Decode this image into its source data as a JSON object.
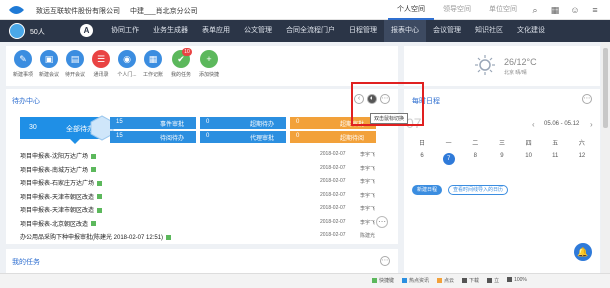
{
  "header": {
    "company": "致远互联软件股份有限公司",
    "branch": "中建___肖北京分公司",
    "tabs": [
      "个人空间",
      "领导空间",
      "单位空间"
    ],
    "active_tab": 0
  },
  "nav": {
    "user": "50人",
    "a_label": "A",
    "items": [
      "协同工作",
      "业务生成器",
      "表单应用",
      "公文管理",
      "合同全流程门户",
      "日程管理",
      "报表中心",
      "会议管理",
      "知识社区",
      "文化建设"
    ],
    "current_index": 6
  },
  "shortcuts": [
    {
      "label": "新建事项",
      "color": "#3b8de0",
      "glyph": "✎"
    },
    {
      "label": "新建会议",
      "color": "#3b8de0",
      "glyph": "▣"
    },
    {
      "label": "待开会议",
      "color": "#3b8de0",
      "glyph": "▤"
    },
    {
      "label": "通讯录",
      "color": "#e94343",
      "glyph": "☰"
    },
    {
      "label": "个人门...",
      "color": "#3b8de0",
      "glyph": "◉"
    },
    {
      "label": "工作记账",
      "color": "#3b8de0",
      "glyph": "▦"
    },
    {
      "label": "我的任务",
      "color": "#5cb85c",
      "glyph": "✔",
      "badge": "10"
    },
    {
      "label": "添加快捷",
      "color": "#5cb85c",
      "glyph": "+"
    }
  ],
  "todo": {
    "title": "待办中心",
    "all": {
      "count": "30",
      "label": "全部待办"
    },
    "categories": [
      {
        "count": "15",
        "label": "事件审批",
        "color": "#2b8fe0"
      },
      {
        "count": "0",
        "label": "超期待办",
        "color": "#2b8fe0"
      },
      {
        "count": "0",
        "label": "超期审批",
        "color": "#f2a13a"
      },
      {
        "count": "15",
        "label": "待阅待办",
        "color": "#2b8fe0"
      },
      {
        "count": "0",
        "label": "代理审批",
        "color": "#2b8fe0"
      },
      {
        "count": "0",
        "label": "超期待阅",
        "color": "#f2a13a"
      }
    ],
    "tasks": [
      {
        "title": "项目申报表-沈阳万达广场",
        "date": "2018-02-07",
        "user": "李宇飞"
      },
      {
        "title": "项目申报表-南城万达广场",
        "date": "2018-02-07",
        "user": "李宇飞"
      },
      {
        "title": "项目申报表-石家庄万达广场",
        "date": "2018-02-07",
        "user": "李宇飞"
      },
      {
        "title": "项目申报表-天津市朝区改造",
        "date": "2018-02-07",
        "user": "李宇飞"
      },
      {
        "title": "项目申报表-天津市朝区改造",
        "date": "2018-02-07",
        "user": "李宇飞"
      },
      {
        "title": "项目申报表-北京朝区改造",
        "date": "2018-02-07",
        "user": "李宇飞"
      },
      {
        "title": "办公用品采购下种申报审批(陈建光 2018-02-07 12:51)",
        "date": "2018-02-07",
        "user": "陈建光"
      }
    ]
  },
  "mytasks": {
    "title": "我的任务"
  },
  "weather": {
    "temp": "26/12°C",
    "sub": "北京 晴/晴"
  },
  "calendar": {
    "title": "每时日程",
    "big_month": "07",
    "range": "05.06 - 05.12",
    "weekdays": [
      "日",
      "一",
      "二",
      "三",
      "四",
      "五",
      "六"
    ],
    "days": [
      "6",
      "7",
      "8",
      "9",
      "10",
      "11",
      "12"
    ],
    "selected_index": 1,
    "btn_primary": "新建日程",
    "btn_secondary": "查看时间线导入的日历"
  },
  "tooltip": "双击鼠标切换",
  "status_bar": [
    {
      "label": "快捷键",
      "color": "#5cb85c"
    },
    {
      "label": "热点资讯",
      "color": "#2b8fe0"
    },
    {
      "label": "点云",
      "color": "#f2a13a"
    },
    {
      "label": "下载",
      "color": "#555"
    },
    {
      "label": "立",
      "color": "#555"
    },
    {
      "label": "100%",
      "color": "#555"
    }
  ]
}
